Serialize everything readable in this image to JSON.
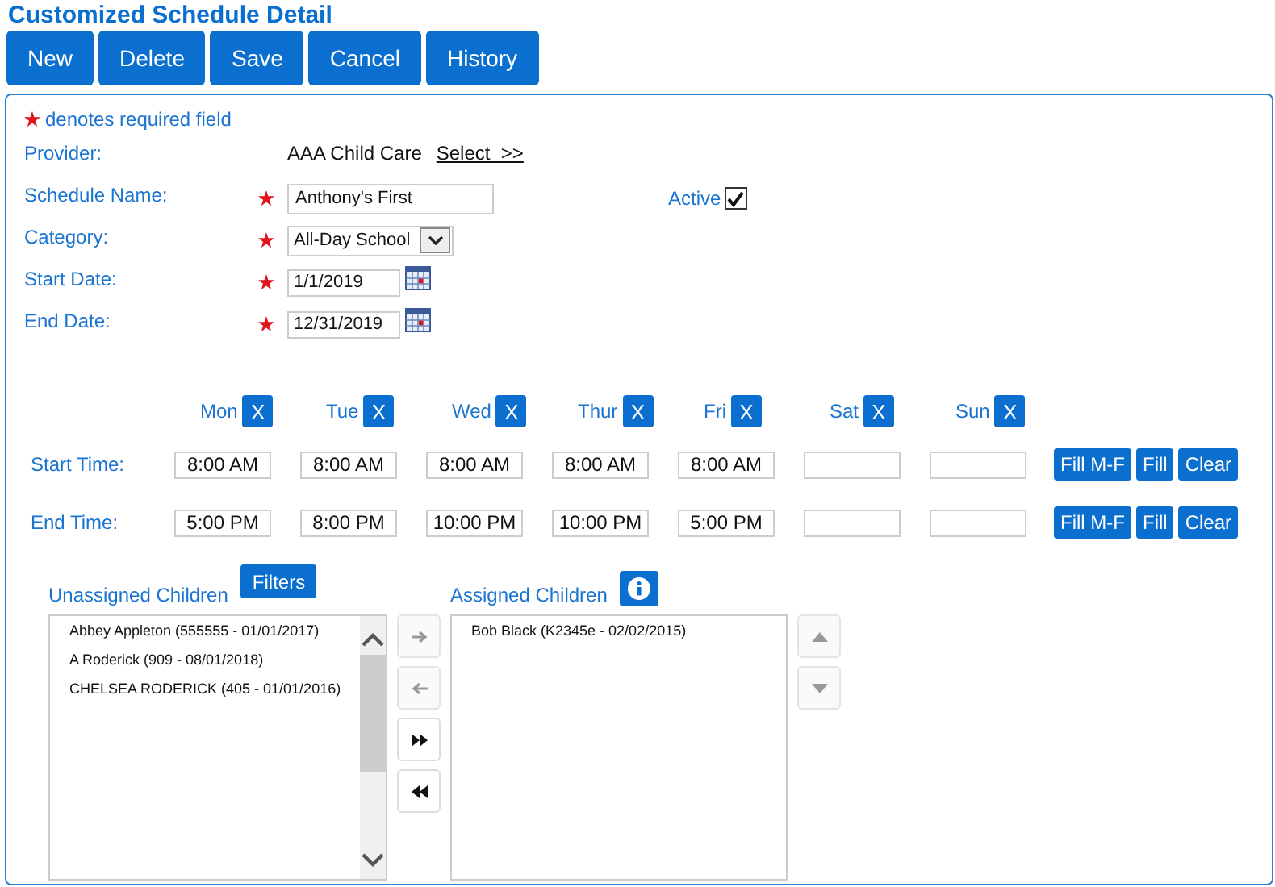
{
  "page_title": "Customized Schedule Detail",
  "toolbar": [
    "New",
    "Delete",
    "Save",
    "Cancel",
    "History"
  ],
  "required_note": "denotes required field",
  "provider": {
    "label": "Provider:",
    "value": "AAA Child Care",
    "link": "Select  >>"
  },
  "fields": [
    {
      "kind": "text",
      "label": "Schedule Name:",
      "required": true,
      "value": "Anthony's First"
    },
    {
      "kind": "select",
      "label": "Category:",
      "required": true,
      "value": "All-Day School"
    },
    {
      "kind": "date",
      "label": "Start Date:",
      "required": true,
      "value": "1/1/2019"
    },
    {
      "kind": "date",
      "label": "End Date:",
      "required": true,
      "value": "12/31/2019"
    }
  ],
  "active": {
    "label": "Active",
    "checked": true
  },
  "days": [
    {
      "label": "Mon",
      "clear": "X"
    },
    {
      "label": "Tue",
      "clear": "X"
    },
    {
      "label": "Wed",
      "clear": "X"
    },
    {
      "label": "Thur",
      "clear": "X"
    },
    {
      "label": "Fri",
      "clear": "X"
    },
    {
      "label": "Sat",
      "clear": "X"
    },
    {
      "label": "Sun",
      "clear": "X"
    }
  ],
  "time_rows": [
    {
      "label": "Start Time:",
      "cells": [
        {
          "kind": "filled",
          "value": "8:00 AM"
        },
        {
          "kind": "filled",
          "value": "8:00 AM"
        },
        {
          "kind": "filled",
          "value": "8:00 AM"
        },
        {
          "kind": "filled",
          "value": "8:00 AM"
        },
        {
          "kind": "filled",
          "value": "8:00 AM"
        },
        {
          "kind": "empty"
        },
        {
          "kind": "empty"
        }
      ],
      "buttons": [
        "Fill M-F",
        "Fill",
        "Clear"
      ]
    },
    {
      "label": "End Time:",
      "cells": [
        {
          "kind": "filled",
          "value": "5:00 PM"
        },
        {
          "kind": "filled",
          "value": "8:00 PM"
        },
        {
          "kind": "filled",
          "value": "10:00 PM"
        },
        {
          "kind": "filled",
          "value": "10:00 PM"
        },
        {
          "kind": "filled",
          "value": "5:00 PM"
        },
        {
          "kind": "empty"
        },
        {
          "kind": "empty"
        }
      ],
      "buttons": [
        "Fill M-F",
        "Fill",
        "Clear"
      ]
    }
  ],
  "unassigned": {
    "label": "Unassigned Children",
    "filter_button": "Filters",
    "items": [
      "Abbey Appleton (555555 - 01/01/2017)",
      "A Roderick (909 - 08/01/2018)",
      "CHELSEA RODERICK (405 - 01/01/2016)"
    ]
  },
  "move_buttons": [
    {
      "kind": "right",
      "disabled": true
    },
    {
      "kind": "left",
      "disabled": true
    },
    {
      "kind": "all-right",
      "disabled": false
    },
    {
      "kind": "all-left",
      "disabled": false
    }
  ],
  "assigned": {
    "label": "Assigned Children",
    "items": [
      "Bob Black (K2345e - 02/02/2015)"
    ]
  },
  "order_buttons": [
    {
      "kind": "up",
      "disabled": true
    },
    {
      "kind": "down",
      "disabled": true
    }
  ]
}
